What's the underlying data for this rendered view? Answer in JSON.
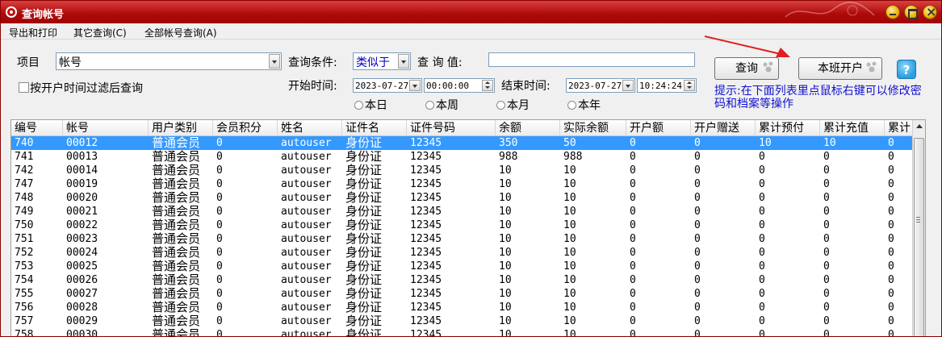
{
  "window": {
    "title": "查询帐号"
  },
  "menu": [
    "导出和打印",
    "其它查询(C)",
    "全部帐号查询(A)"
  ],
  "query": {
    "item_label": "项目",
    "item_value": "帐号",
    "condition_label": "查询条件:",
    "condition_value": "类似于",
    "value_label": "查 询 值:",
    "value_input": "",
    "filter_checkbox_label": "按开户时间过滤后查询",
    "start_label": "开始时间:",
    "start_date": "2023-07-27",
    "start_time": "00:00:00",
    "end_label": "结束时间:",
    "end_date": "2023-07-27",
    "end_time": "10:24:24",
    "radios": [
      "本日",
      "本周",
      "本月",
      "本年"
    ],
    "search_button": "查询",
    "open_shift_button": "本班开户",
    "help_label": "?",
    "hint": "提示:在下面列表里点鼠标右键可以修改密码和档案等操作"
  },
  "table": {
    "columns": [
      "编号",
      "帐号",
      "用户类别",
      "会员积分",
      "姓名",
      "证件名",
      "证件号码",
      "余额",
      "实际余额",
      "开户额",
      "开户赠送",
      "累计预付",
      "累计充值",
      "累计"
    ],
    "selected_index": 0,
    "rows": [
      [
        "740",
        "00012",
        "普通会员",
        "0",
        "autouser",
        "身份证",
        "12345",
        "350",
        "50",
        "0",
        "0",
        "10",
        "10",
        "0"
      ],
      [
        "741",
        "00013",
        "普通会员",
        "0",
        "autouser",
        "身份证",
        "12345",
        "988",
        "988",
        "0",
        "0",
        "0",
        "0",
        "0"
      ],
      [
        "742",
        "00014",
        "普通会员",
        "0",
        "autouser",
        "身份证",
        "12345",
        "10",
        "10",
        "0",
        "0",
        "0",
        "0",
        "0"
      ],
      [
        "747",
        "00019",
        "普通会员",
        "0",
        "autouser",
        "身份证",
        "12345",
        "10",
        "10",
        "0",
        "0",
        "0",
        "0",
        "0"
      ],
      [
        "748",
        "00020",
        "普通会员",
        "0",
        "autouser",
        "身份证",
        "12345",
        "10",
        "10",
        "0",
        "0",
        "0",
        "0",
        "0"
      ],
      [
        "749",
        "00021",
        "普通会员",
        "0",
        "autouser",
        "身份证",
        "12345",
        "10",
        "10",
        "0",
        "0",
        "0",
        "0",
        "0"
      ],
      [
        "750",
        "00022",
        "普通会员",
        "0",
        "autouser",
        "身份证",
        "12345",
        "10",
        "10",
        "0",
        "0",
        "0",
        "0",
        "0"
      ],
      [
        "751",
        "00023",
        "普通会员",
        "0",
        "autouser",
        "身份证",
        "12345",
        "10",
        "10",
        "0",
        "0",
        "0",
        "0",
        "0"
      ],
      [
        "752",
        "00024",
        "普通会员",
        "0",
        "autouser",
        "身份证",
        "12345",
        "10",
        "10",
        "0",
        "0",
        "0",
        "0",
        "0"
      ],
      [
        "753",
        "00025",
        "普通会员",
        "0",
        "autouser",
        "身份证",
        "12345",
        "10",
        "10",
        "0",
        "0",
        "0",
        "0",
        "0"
      ],
      [
        "754",
        "00026",
        "普通会员",
        "0",
        "autouser",
        "身份证",
        "12345",
        "10",
        "10",
        "0",
        "0",
        "0",
        "0",
        "0"
      ],
      [
        "755",
        "00027",
        "普通会员",
        "0",
        "autouser",
        "身份证",
        "12345",
        "10",
        "10",
        "0",
        "0",
        "0",
        "0",
        "0"
      ],
      [
        "756",
        "00028",
        "普通会员",
        "0",
        "autouser",
        "身份证",
        "12345",
        "10",
        "10",
        "0",
        "0",
        "0",
        "0",
        "0"
      ],
      [
        "757",
        "00029",
        "普通会员",
        "0",
        "autouser",
        "身份证",
        "12345",
        "10",
        "10",
        "0",
        "0",
        "0",
        "0",
        "0"
      ],
      [
        "758",
        "00030",
        "普通会员",
        "0",
        "autouser",
        "身份证",
        "12345",
        "10",
        "10",
        "0",
        "0",
        "0",
        "0",
        "0"
      ]
    ]
  },
  "colors": {
    "titlebar": "#b00c0c",
    "selection": "#3399ff",
    "hint": "#1010d0",
    "annotation_arrow": "#e02020"
  }
}
